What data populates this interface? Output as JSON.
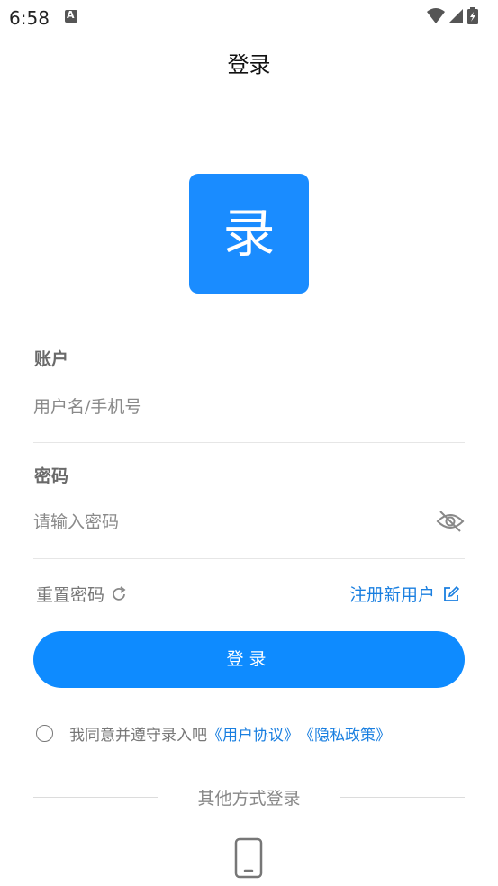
{
  "status_bar": {
    "time": "6:58",
    "notification_icon": "A"
  },
  "header": {
    "title": "登录"
  },
  "logo": {
    "text": "录",
    "color": "#1a8cff"
  },
  "account": {
    "label": "账户",
    "placeholder": "用户名/手机号"
  },
  "password": {
    "label": "密码",
    "placeholder": "请输入密码"
  },
  "links": {
    "reset": "重置密码",
    "register": "注册新用户"
  },
  "login_button": {
    "label": "登录"
  },
  "agreement": {
    "text": "我同意并遵守录入吧",
    "user_agreement": "《用户协议》",
    "privacy_policy": "《隐私政策》"
  },
  "other_login": {
    "label": "其他方式登录"
  },
  "colors": {
    "accent": "#0e8bff",
    "link": "#1a7fe0"
  }
}
